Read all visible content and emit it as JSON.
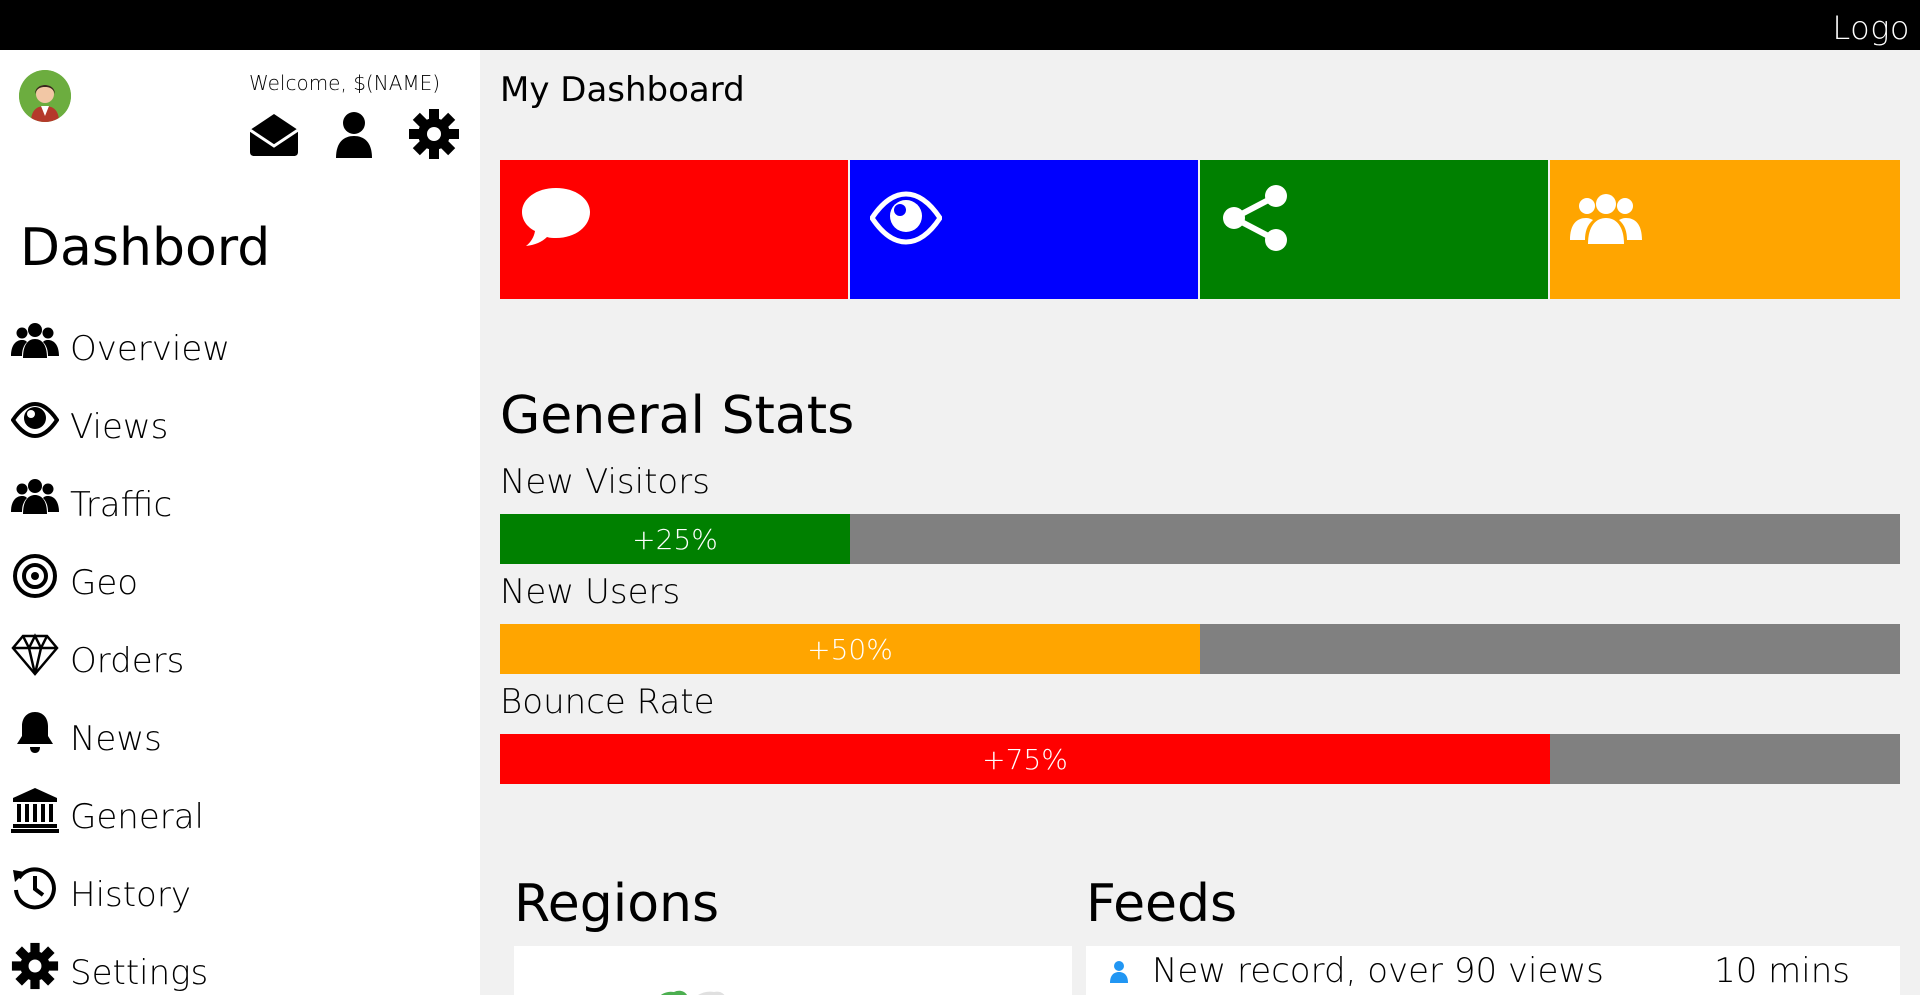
{
  "topbar": {
    "logo": "Logo"
  },
  "sidebar": {
    "welcome": "Welcome, $(NAME)",
    "header_icons": [
      "envelope-icon",
      "user-icon",
      "cog-icon"
    ],
    "title": "Dashbord",
    "items": [
      {
        "label": "Overview",
        "icon": "users-icon"
      },
      {
        "label": "Views",
        "icon": "eye-icon"
      },
      {
        "label": "Traffic",
        "icon": "users-icon"
      },
      {
        "label": "Geo",
        "icon": "bullseye-icon"
      },
      {
        "label": "Orders",
        "icon": "diamond-icon"
      },
      {
        "label": "News",
        "icon": "bell-icon"
      },
      {
        "label": "General",
        "icon": "bank-icon"
      },
      {
        "label": "History",
        "icon": "history-icon"
      },
      {
        "label": "Settings",
        "icon": "cog-icon"
      }
    ]
  },
  "main": {
    "title": "My Dashboard",
    "tiles": [
      {
        "icon": "comment-icon",
        "color": "#ff0000"
      },
      {
        "icon": "eye-icon",
        "color": "#0000ff"
      },
      {
        "icon": "share-icon",
        "color": "#008000"
      },
      {
        "icon": "users-icon",
        "color": "#ffa500"
      }
    ],
    "stats": {
      "title": "General Stats",
      "items": [
        {
          "label": "New Visitors",
          "value": "+25%",
          "percent": 25,
          "color": "#008000"
        },
        {
          "label": "New Users",
          "value": "+50%",
          "percent": 50,
          "color": "#ffa500"
        },
        {
          "label": "Bounce Rate",
          "value": "+75%",
          "percent": 75,
          "color": "#ff0000"
        }
      ]
    },
    "regions": {
      "title": "Regions"
    },
    "feeds": {
      "title": "Feeds",
      "items": [
        {
          "text": "New record, over 90 views",
          "time": "10 mins",
          "icon": "user-icon",
          "icon_color": "#2196f3"
        }
      ]
    }
  }
}
